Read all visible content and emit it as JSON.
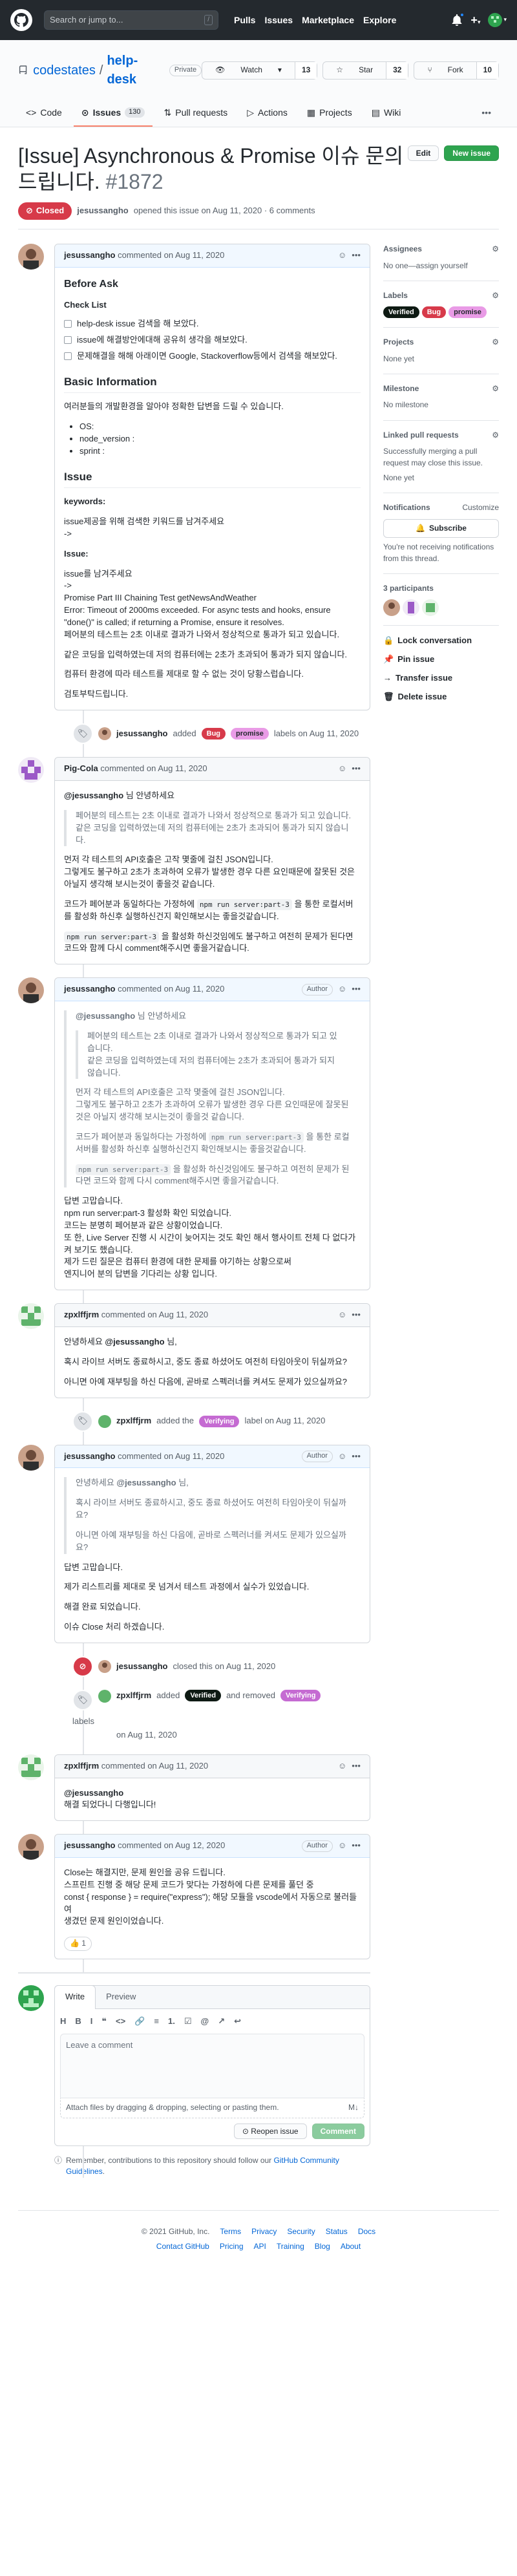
{
  "header": {
    "search_placeholder": "Search or jump to...",
    "search_key": "/",
    "nav": [
      "Pulls",
      "Issues",
      "Marketplace",
      "Explore"
    ],
    "icons": [
      "github-octocat-icon",
      "bell-icon",
      "plus-icon",
      "avatar"
    ]
  },
  "repo": {
    "owner": "codestates",
    "name": "help-desk",
    "visibility": "Private",
    "watch_label": "Watch",
    "watch_count": "13",
    "star_label": "Star",
    "star_count": "32",
    "fork_label": "Fork",
    "fork_count": "10"
  },
  "tabs": [
    {
      "label": "Code",
      "icon": "code-icon"
    },
    {
      "label": "Issues",
      "count": "130",
      "icon": "issue-icon"
    },
    {
      "label": "Pull requests",
      "icon": "pr-icon"
    },
    {
      "label": "Actions",
      "icon": "play-icon"
    },
    {
      "label": "Projects",
      "icon": "project-icon"
    },
    {
      "label": "Wiki",
      "icon": "book-icon"
    }
  ],
  "issue": {
    "title": "[Issue] Asynchronous & Promise 이슈 문의드립니다.",
    "number": "#1872",
    "edit_label": "Edit",
    "new_label": "New issue",
    "state": "Closed",
    "opened_by": "jesussangho",
    "opened_text": "opened this issue on Aug 11, 2020 · 6 comments"
  },
  "comments": {
    "c1": {
      "author": "jesussangho",
      "time": "commented on Aug 11, 2020",
      "h_before": "Before Ask",
      "h_check": "Check List",
      "checks": [
        "help-desk issue 검색을 해 보았다.",
        "issue에 해결방안에대해 공유히 생각을 해보았다.",
        "문제해결을 해해 아래이면 Google, Stackoverflow등에서 검색을 해보았다."
      ],
      "h_basic": "Basic Information",
      "basic_text": "여러분들의 개발환경을 알아야 정확한 답변을 드릴 수 있습니다.",
      "basic_list": [
        "OS:",
        "node_version :",
        "sprint :"
      ],
      "h_issue": "Issue",
      "keywords_label": "keywords:",
      "keywords_text": "issue제공을 위해 검색한 키워드를 남겨주세요",
      "arrow": "->",
      "issue_label": "Issue:",
      "issue_lines": [
        "issue를 남겨주세요",
        "->",
        "Promise Part III Chaining Test getNewsAndWeather",
        "Error: Timeout of 2000ms exceeded. For async tests and hooks, ensure \"done()\" is called; if returning a Promise, ensure it resolves.",
        "페어분의 테스트는 2초 이내로 결과가 나와서 정상적으로 통과가 되고 있습니다."
      ],
      "p2": "같은 코딩을 입력하였는데 저의 컴퓨터에는 2초가 초과되어 통과가 되지 않습니다.",
      "p3": "컴퓨터 환경에 따라 테스트를 제대로 할 수 없는 것이 당황스럽습니다.",
      "p4": "검토부탁드립니다."
    },
    "ev1": {
      "actor": "jesussangho",
      "verb": "added",
      "labels": [
        "Bug",
        "promise"
      ],
      "tail": "labels on Aug 11, 2020"
    },
    "c2": {
      "author": "Pig-Cola",
      "time": "commented on Aug 11, 2020",
      "mention": "@jesussangho",
      "mention_tail": " 님 안녕하세요",
      "q1": "페어분의 테스트는 2초 이내로 결과가 나와서 정상적으로 통과가 되고 있습니다.",
      "q2": "같은 코딩을 입력하였는데 저의 컴퓨터에는 2초가 초과되어 통과가 되지 않습니다.",
      "p1": "먼저 각 테스트의 API호출은 고작 몇줄에 걸친 JSON입니다.",
      "p2": "그렇게도 불구하고 2초가 초과하여 오류가 발생한 경우 다른 요인때문에 잘못된 것은 아닐지 생각해 보시는것이 좋을것 같습니다.",
      "p3a": "코드가 페어분과 동일하다는 가정하에 ",
      "code1": "npm run server:part-3",
      "p3b": " 을 통한 로컬서버를 활성화 하신후 실행하신건지 확인해보시는 좋을것같습니다.",
      "code2": "npm run server:part-3",
      "p4": " 을 활성화 하신것임에도 불구하고 여전히 문제가 된다면 코드와 함께 다시 comment해주시면 좋을거같습니다."
    },
    "c3": {
      "author": "jesussangho",
      "time": "commented on Aug 11, 2020",
      "role": "Author",
      "qmention": "@jesussangho",
      "qmention_tail": " 님 안녕하세요",
      "q1": "페어분의 테스트는 2초 이내로 결과가 나와서 정상적으로 통과가 되고 있습니다.",
      "q2": "같은 코딩을 입력하였는데 저의 컴퓨터에는 2초가 초과되어 통과가 되지 않습니다.",
      "q3": "먼저 각 테스트의 API호출은 고작 몇줄에 걸친 JSON입니다.",
      "q4": "그렇게도 불구하고 2초가 초과하여 오류가 발생한 경우 다른 요인때문에 잘못된 것은 아닐지 생각해 보시는것이 좋을것 같습니다.",
      "q5a": "코드가 페어분과 동일하다는 가정하에 ",
      "qcode1": "npm run server:part-3",
      "q5b": " 을 통한 로컬 서버를 활성화 하신후 실행하신건지 확인해보시는 좋을것같습니다.",
      "qcode2": "npm run server:part-3",
      "q6": " 을 활성화 하신것임에도 불구하고 여전히 문제가 된다면 코드와 함께 다시 comment해주시면 좋을거같습니다.",
      "lines": [
        "답변 고맙습니다.",
        "npm run server:part-3 활성화 확인 되었습니다.",
        "코드는 분명히 페어분과 같은 상황이었습니다.",
        "또 한, Live Server 진행 시 시간이 늦어지는 것도 확인 해서 행사이트 전체 다 없다가 켜 보기도 했습니다.",
        "제가 드린 질문은 컴퓨터 환경에 대한 문제를 야기하는 상황으로써",
        "엔지니어 분의 답변을 기다리는 상황 입니다."
      ]
    },
    "c4": {
      "author": "zpxlffjrm",
      "time": "commented on Aug 11, 2020",
      "line1a": "안녕하세요 ",
      "line1b": "@jesussangho",
      "line1c": " 님,",
      "p1": "혹시 라이브 서버도 종료하시고, 중도 종료 하셨어도 여전히 타임아웃이 뒤실까요?",
      "p2": "아니면 아예 재부팅을 하신 다음에, 곧바로 스펙러너를 켜셔도 문제가 있으실까요?"
    },
    "ev2": {
      "actor": "zpxlffjrm",
      "verb": "added the",
      "label": "Verifying",
      "tail": "label on Aug 11, 2020"
    },
    "c5": {
      "author": "jesussangho",
      "time": "commented on Aug 11, 2020",
      "role": "Author",
      "q1a": "안녕하세요 ",
      "q1b": "@jesussangho",
      "q1c": " 님,",
      "q2": "혹시 라이브 서버도 종료하시고, 중도 종료 하셨어도 여전히 타임아웃이 뒤실까요?",
      "q3": "아니면 아예 재부팅을 하신 다음에, 곧바로 스펙러너를 켜셔도 문제가 있으실까요?",
      "p1": "답변 고맙습니다.",
      "p2": "제가 리스트리를 제대로 못 넘겨서 테스트 과정에서 실수가 있었습니다.",
      "p3": "해결 완료 되었습니다.",
      "p4": "이슈 Close 처리 하겠습니다."
    },
    "ev3": {
      "actor": "jesussangho",
      "tail": "closed this on Aug 11, 2020"
    },
    "ev4": {
      "actor": "zpxlffjrm",
      "verb": "added",
      "label1": "Verified",
      "mid": "and removed",
      "label2": "Verifying",
      "tail": "labels",
      "date": "on Aug 11, 2020"
    },
    "c6": {
      "author": "zpxlffjrm",
      "time": "commented on Aug 11, 2020",
      "mention": "@jesussangho",
      "p1": "해결 되었다니 다행입니다!"
    },
    "c7": {
      "author": "jesussangho",
      "time": "commented on Aug 12, 2020",
      "role": "Author",
      "lines": [
        "Close는 해결지만, 문제 원인을 공유 드립니다.",
        "스프린트 진행 중 해당 문제 코드가 맞다는 가정하에 다른 문제를 풀던 중",
        "const { response } = require(\"express\"); 해당 모듈을 vscode에서 자동으로 불러들여",
        "생겼던 문제 원인이었습니다."
      ],
      "reaction": "👍 1"
    }
  },
  "editor": {
    "write_tab": "Write",
    "preview_tab": "Preview",
    "tools": [
      "H",
      "B",
      "I",
      "❝",
      "<>",
      "🔗",
      "≡",
      "1.",
      "☑",
      "@",
      "↗",
      "↩"
    ],
    "placeholder": "Leave a comment",
    "attach": "Attach files by dragging & dropping, selecting or pasting them.",
    "md": "M↓",
    "reopen": "Reopen issue",
    "comment": "Comment"
  },
  "note": {
    "text": "Remember, contributions to this repository should follow our ",
    "link": "GitHub Community Guidelines",
    "end": "."
  },
  "sidebar": {
    "assignees_title": "Assignees",
    "assignees_val": "No one—assign yourself",
    "labels_title": "Labels",
    "labels": [
      {
        "name": "Verified",
        "color": "#0e1a13",
        "fg": "#ffffff"
      },
      {
        "name": "Bug",
        "color": "#d73a4a",
        "fg": "#ffffff"
      },
      {
        "name": "promise",
        "color": "#e99be6",
        "fg": "#24292e"
      }
    ],
    "projects_title": "Projects",
    "projects_val": "None yet",
    "milestone_title": "Milestone",
    "milestone_val": "No milestone",
    "linked_title": "Linked pull requests",
    "linked_desc": "Successfully merging a pull request may close this issue.",
    "linked_val": "None yet",
    "notif_title": "Notifications",
    "notif_customize": "Customize",
    "subscribe": "Subscribe",
    "notif_desc": "You're not receiving notifications from this thread.",
    "participants": "3 participants",
    "lock": "Lock conversation",
    "pin": "Pin issue",
    "transfer": "Transfer issue",
    "delete": "Delete issue"
  },
  "footer": {
    "copy": "© 2021 GitHub, Inc.",
    "row1": [
      "Terms",
      "Privacy",
      "Security",
      "Status",
      "Docs"
    ],
    "row2": [
      "Contact GitHub",
      "Pricing",
      "API",
      "Training",
      "Blog",
      "About"
    ]
  },
  "colors": {
    "closed": "#d73a49",
    "green": "#2ea44f",
    "link": "#0366d6",
    "bug": "#d73a4a",
    "promise": "#e99be6",
    "verifying": "#c56bd2",
    "verified": "#0e1a13"
  }
}
